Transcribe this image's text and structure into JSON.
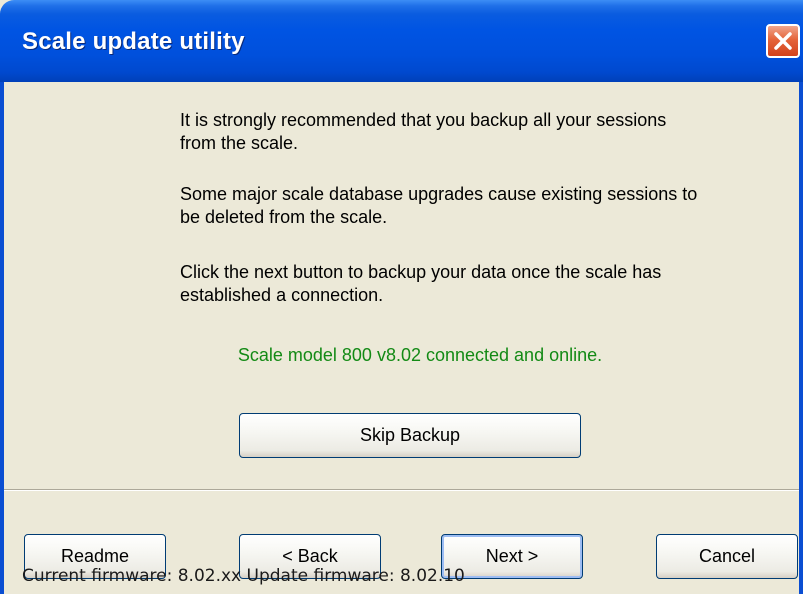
{
  "window": {
    "title": "Scale update utility"
  },
  "message": {
    "paragraph1": "It is strongly recommended that you backup all your sessions from the scale.",
    "paragraph2": "Some major scale database upgrades cause existing sessions to be deleted from the scale.",
    "paragraph3": "Click the next button to backup your data once the scale has established a connection."
  },
  "status": {
    "text": "Scale model 800 v8.02 connected and online.",
    "color": "#138a15"
  },
  "buttons": {
    "skip_backup": "Skip Backup",
    "readme": "Readme",
    "back": "< Back",
    "next": "Next >",
    "cancel": "Cancel"
  },
  "footer": {
    "firmware": "Current firmware: 8.02.xx Update firmware: 8.02.10"
  },
  "colors": {
    "titlebar": "#0054e3",
    "background": "#ece9d8",
    "close_button": "#e5643a"
  },
  "icons": {
    "close": "close-icon"
  }
}
